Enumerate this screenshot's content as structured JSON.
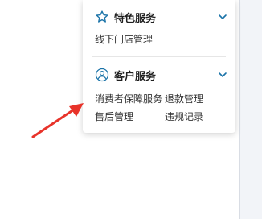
{
  "panel": {
    "featured": {
      "title": "特色服务",
      "icon": "star-icon",
      "links": [
        "线下门店管理"
      ]
    },
    "customer": {
      "title": "客户服务",
      "icon": "user-icon",
      "links": [
        "消费者保障服务",
        "退款管理",
        "售后管理",
        "违规记录"
      ]
    }
  },
  "colors": {
    "accent": "#1a73a8",
    "annotation_arrow": "#e8332a"
  }
}
